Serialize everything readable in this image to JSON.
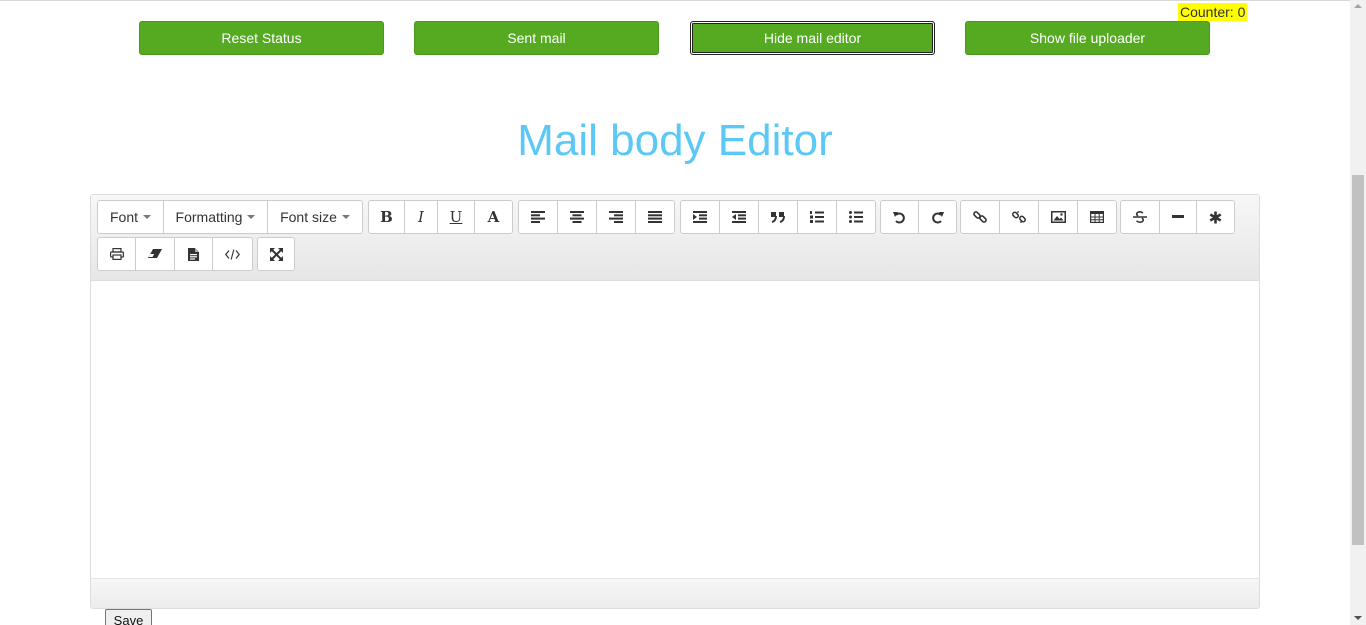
{
  "counter": "Counter: 0",
  "top_buttons": {
    "reset": "Reset Status",
    "sent": "Sent mail",
    "hide_editor": "Hide mail editor",
    "show_uploader": "Show file uploader"
  },
  "heading": "Mail body Editor",
  "toolbar": {
    "font": "Font",
    "formatting": "Formatting",
    "font_size": "Font size",
    "bold": "B",
    "italic": "I",
    "underline": "U",
    "font_color": "A",
    "icons": [
      "bold-icon",
      "italic-icon",
      "underline-icon",
      "font-color-icon",
      "align-left-icon",
      "align-center-icon",
      "align-right-icon",
      "align-justify-icon",
      "indent-icon",
      "outdent-icon",
      "blockquote-icon",
      "ordered-list-icon",
      "unordered-list-icon",
      "undo-icon",
      "redo-icon",
      "link-icon",
      "unlink-icon",
      "image-icon",
      "table-icon",
      "strikethrough-icon",
      "horizontal-rule-icon",
      "special-char-icon",
      "print-icon",
      "eraser-icon",
      "document-icon",
      "code-icon",
      "fullscreen-icon"
    ]
  },
  "save": "Save",
  "colors": {
    "button_green": "#55aa22",
    "heading_blue": "#5bc8f5",
    "counter_bg": "#ffff00"
  }
}
